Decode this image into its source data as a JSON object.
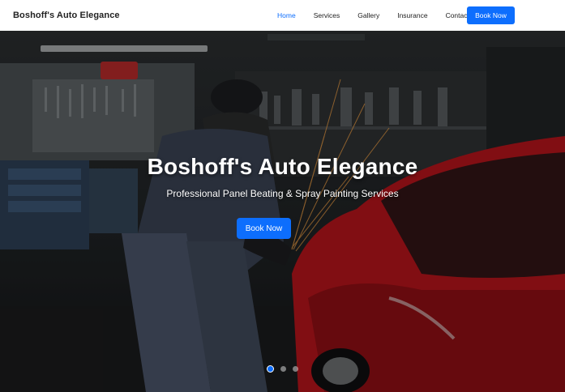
{
  "navbar": {
    "brand": "Boshoff's Auto Elegance",
    "links": [
      {
        "label": "Home",
        "active": true
      },
      {
        "label": "Services",
        "active": false
      },
      {
        "label": "Gallery",
        "active": false
      },
      {
        "label": "Insurance",
        "active": false
      },
      {
        "label": "Contact",
        "active": false
      }
    ],
    "cta_label": "Book Now"
  },
  "hero": {
    "title": "Boshoff's Auto Elegance",
    "subtitle": "Professional Panel Beating & Spray Painting Services",
    "cta_label": "Book Now",
    "background_description": "workshop-mechanic-grinding-red-car"
  },
  "carousel": {
    "slide_count": 3,
    "active_index": 0
  },
  "colors": {
    "accent": "#0d6efd",
    "navbar_bg": "#ffffff",
    "car_red": "#c0141c"
  }
}
